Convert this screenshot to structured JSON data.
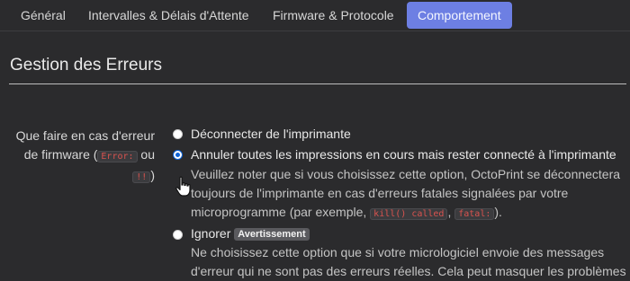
{
  "tabs": [
    {
      "label": "Général"
    },
    {
      "label": "Intervalles & Délais d'Attente"
    },
    {
      "label": "Firmware & Protocole"
    },
    {
      "label": "Comportement",
      "active": true
    }
  ],
  "section": {
    "title": "Gestion des Erreurs"
  },
  "field": {
    "label_part1": "Que faire en cas d'erreur de firmware (",
    "code1": "Error:",
    "label_part2": " ou ",
    "code2": "!!",
    "label_part3": ")"
  },
  "options": [
    {
      "label": "Déconnecter de l'imprimante",
      "checked": false
    },
    {
      "label": "Annuler toutes les impressions en cours mais rester connecté à l'imprimante",
      "checked": true,
      "desc_part1": "Veuillez noter que si vous choisissez cette option, OctoPrint se déconnectera toujours de l'imprimante en cas d'erreurs fatales signalées par votre microprogramme (par exemple, ",
      "code1": "kill() called",
      "desc_part2": ", ",
      "code2": "fatal:",
      "desc_part3": ")."
    },
    {
      "label": "Ignorer",
      "badge": "Avertissement",
      "checked": false,
      "desc": "Ne choisissez cette option que si votre micrologiciel envoie des messages d'erreur qui ne sont pas des erreurs réelles. Cela peut masquer les problèmes"
    }
  ],
  "colors": {
    "accent": "#6d7fe3",
    "background": "#2b2b2d",
    "code_text": "#d9534f",
    "radio_checked": "#0d63d8"
  }
}
